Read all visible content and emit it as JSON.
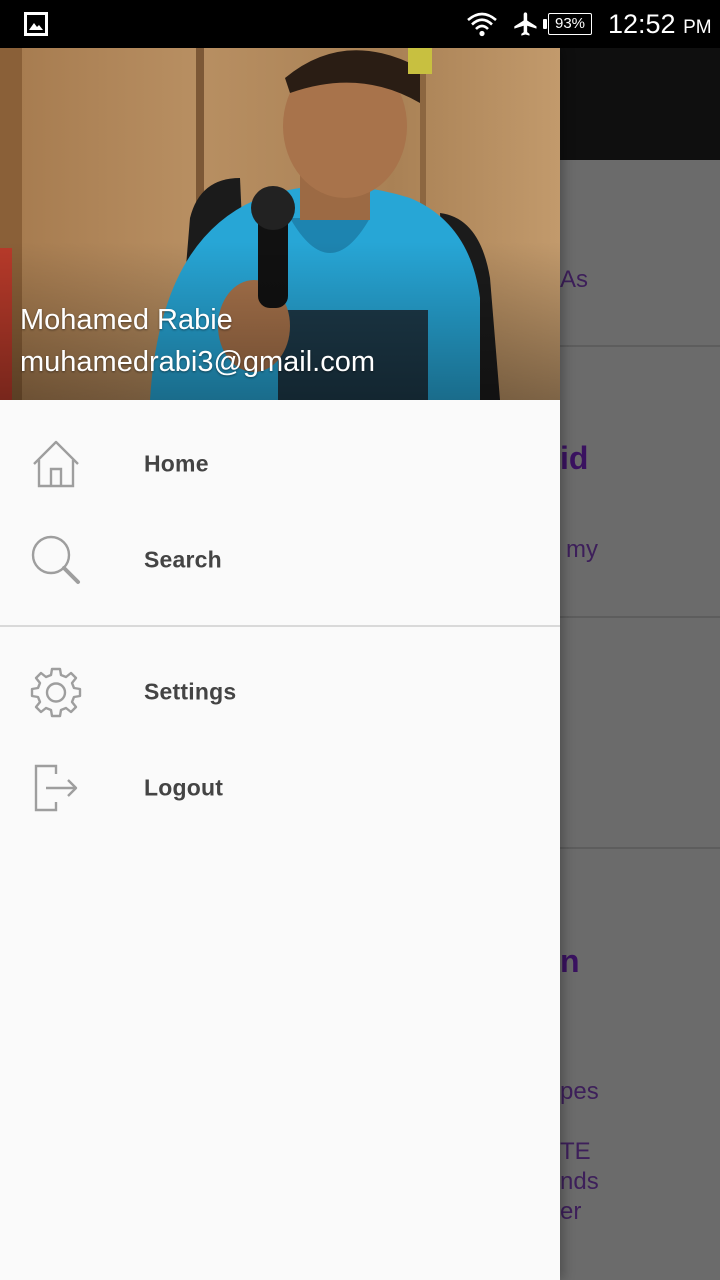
{
  "status_bar": {
    "battery": "93%",
    "time": "12:52",
    "ampm": "PM",
    "icons": [
      "gallery-icon",
      "wifi-icon",
      "airplane-mode-icon",
      "battery-icon"
    ]
  },
  "drawer": {
    "header": {
      "user_name": "Mohamed Rabie",
      "user_email": "muhamedrabi3@gmail.com"
    },
    "menu_group_1": [
      {
        "label": "Home",
        "icon": "home-icon"
      },
      {
        "label": "Search",
        "icon": "search-icon"
      }
    ],
    "menu_group_2": [
      {
        "label": "Settings",
        "icon": "gear-icon"
      },
      {
        "label": "Logout",
        "icon": "logout-icon"
      }
    ]
  },
  "background_content": {
    "fragments": [
      "As",
      "id",
      "my",
      "n",
      "pes",
      "TE",
      "nds",
      "er"
    ]
  },
  "colors": {
    "drawer_bg": "#fafafa",
    "label_text": "#444444",
    "icon_stroke": "#9e9e9e",
    "accent_purple": "#3a1260"
  }
}
